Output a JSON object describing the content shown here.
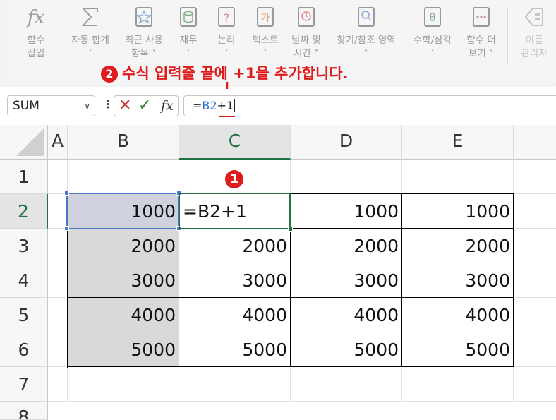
{
  "ribbon": {
    "buttons": [
      {
        "name": "insert-function",
        "line1": "함수",
        "line2": "삽입",
        "icon": "fx-icon"
      },
      {
        "name": "autosum",
        "line1": "자동 합계",
        "line2": "˅",
        "icon": "sigma-icon"
      },
      {
        "name": "recently-used",
        "line1": "최근 사용",
        "line2": "항목 ˅",
        "icon": "star-book-icon"
      },
      {
        "name": "financial",
        "line1": "재무",
        "line2": "˅",
        "icon": "coins-book-icon"
      },
      {
        "name": "logical",
        "line1": "논리",
        "line2": "˅",
        "icon": "question-book-icon"
      },
      {
        "name": "text",
        "line1": "텍스트",
        "line2": "˅",
        "icon": "ga-book-icon"
      },
      {
        "name": "date-time",
        "line1": "날짜 및",
        "line2": "시간 ˅",
        "icon": "clock-book-icon"
      },
      {
        "name": "lookup-reference",
        "line1": "찾기/참조 영역",
        "line2": "˅",
        "icon": "magnifier-book-icon"
      },
      {
        "name": "math-trig",
        "line1": "수학/삼각",
        "line2": "˅",
        "icon": "theta-book-icon"
      },
      {
        "name": "more-functions",
        "line1": "함수 더",
        "line2": "보기 ˅",
        "icon": "dots-book-icon"
      },
      {
        "name": "name-manager",
        "line1": "이름",
        "line2": "관리자",
        "icon": "tag-icon"
      }
    ]
  },
  "annotation": {
    "step_number": "2",
    "text": "수식 입력줄 끝에 +1을 추가합니다.",
    "cell_marker": "1"
  },
  "formula_bar": {
    "name_box": "SUM",
    "formula_prefix": "=",
    "formula_ref": "B2",
    "formula_suffix": "+1"
  },
  "grid": {
    "columns": [
      "A",
      "B",
      "C",
      "D",
      "E"
    ],
    "rows": [
      "1",
      "2",
      "3",
      "4",
      "5",
      "6",
      "7",
      "8"
    ],
    "cells": {
      "B2": "1000",
      "C2": "=B2+1",
      "D2": "1000",
      "E2": "1000",
      "B3": "2000",
      "C3": "2000",
      "D3": "2000",
      "E3": "2000",
      "B4": "3000",
      "C4": "3000",
      "D4": "3000",
      "E4": "3000",
      "B5": "4000",
      "C5": "4000",
      "D5": "4000",
      "E5": "4000",
      "B6": "5000",
      "C6": "5000",
      "D6": "5000",
      "E6": "5000"
    },
    "active_column": "C",
    "active_row": "2"
  },
  "colors": {
    "annotation_red": "#e01b1b",
    "excel_green": "#217346",
    "reference_blue": "#2a6fd0"
  }
}
